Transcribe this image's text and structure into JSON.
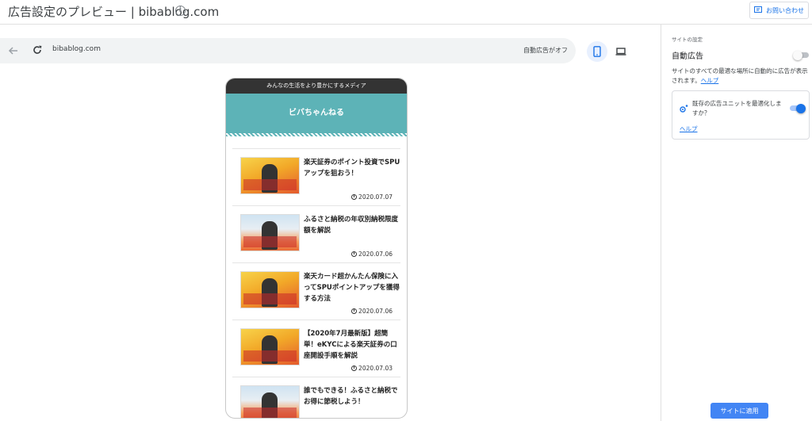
{
  "header": {
    "title": "広告設定のプレビュー | bibablog.com",
    "contact_label": "お問い合わせ"
  },
  "browser": {
    "url": "bibablog.com",
    "auto_ads_status": "自動広告がオフ"
  },
  "preview": {
    "tagline": "みんなの生活をより豊かにするメディア",
    "site_name": "ビバちゃんねる",
    "posts": [
      {
        "title": "楽天証券のポイント投資でSPUアップを狙おう！",
        "date": "2020.07.07",
        "thumb": "gold"
      },
      {
        "title": "ふるさと納税の年収別納税限度額を解説",
        "date": "2020.07.06",
        "thumb": "sky"
      },
      {
        "title": "楽天カード超かんたん保険に入ってSPUポイントアップを獲得する方法",
        "date": "2020.07.06",
        "thumb": "gold"
      },
      {
        "title": "【2020年7月最新版】超簡単！eKYCによる楽天証券の口座開設手順を解説",
        "date": "2020.07.03",
        "thumb": "gold"
      },
      {
        "title": "誰でもできる！ふるさと納税でお得に節税しよう！",
        "date": "",
        "thumb": "sky"
      }
    ]
  },
  "settings": {
    "section_label": "サイトの設定",
    "auto_ads_label": "自動広告",
    "auto_ads_enabled": false,
    "description": "サイトのすべての最適な場所に自動的に広告が表示されます。",
    "help_label": "ヘルプ",
    "optimize_question": "既存の広告ユニットを最適化しますか？",
    "optimize_enabled": true,
    "optimize_help_label": "ヘルプ",
    "apply_label": "サイトに適用"
  }
}
